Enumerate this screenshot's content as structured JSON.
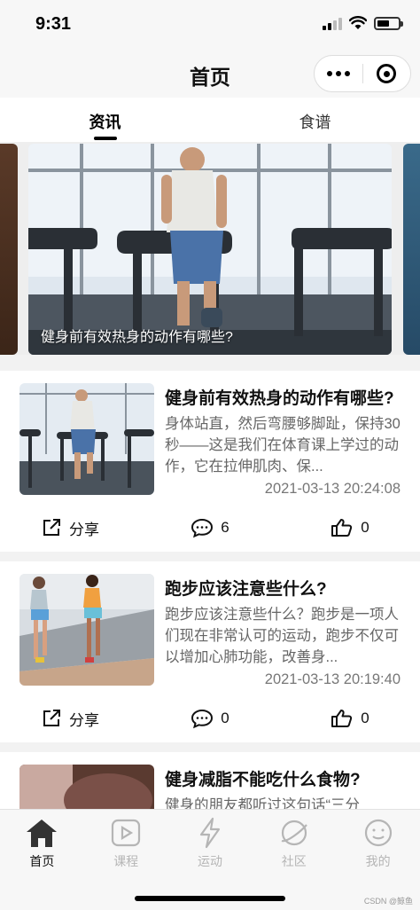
{
  "status_bar": {
    "time": "9:31"
  },
  "nav": {
    "title": "首页"
  },
  "tabs": [
    {
      "label": "资讯",
      "active": true
    },
    {
      "label": "食谱",
      "active": false
    }
  ],
  "carousel": {
    "caption": "健身前有效热身的动作有哪些?"
  },
  "articles": [
    {
      "title": "健身前有效热身的动作有哪些?",
      "summary": "身体站直，然后弯腰够脚趾，保持30秒——这是我们在体育课上学过的动作，它在拉伸肌肉、保...",
      "time": "2021-03-13 20:24:08",
      "share_label": "分享",
      "comments": "6",
      "likes": "0"
    },
    {
      "title": "跑步应该注意些什么?",
      "summary": "跑步应该注意些什么？跑步是一项人们现在非常认可的运动，跑步不仅可以增加心肺功能，改善身...",
      "time": "2021-03-13 20:19:40",
      "share_label": "分享",
      "comments": "0",
      "likes": "0"
    },
    {
      "title": "健身减脂不能吃什么食物?",
      "summary": "健身的朋友都听过这句话“三分",
      "time": "",
      "share_label": "",
      "comments": "",
      "likes": ""
    }
  ],
  "tabbar": [
    {
      "label": "首页",
      "icon": "home-icon",
      "active": true
    },
    {
      "label": "课程",
      "icon": "play-icon",
      "active": false
    },
    {
      "label": "运动",
      "icon": "lightning-icon",
      "active": false
    },
    {
      "label": "社区",
      "icon": "planet-icon",
      "active": false
    },
    {
      "label": "我的",
      "icon": "smiley-icon",
      "active": false
    }
  ],
  "watermark": "CSDN @鲸鱼",
  "colors": {
    "accent": "#000000",
    "inactive": "#b5b5b5",
    "background": "#f2f2f2"
  }
}
